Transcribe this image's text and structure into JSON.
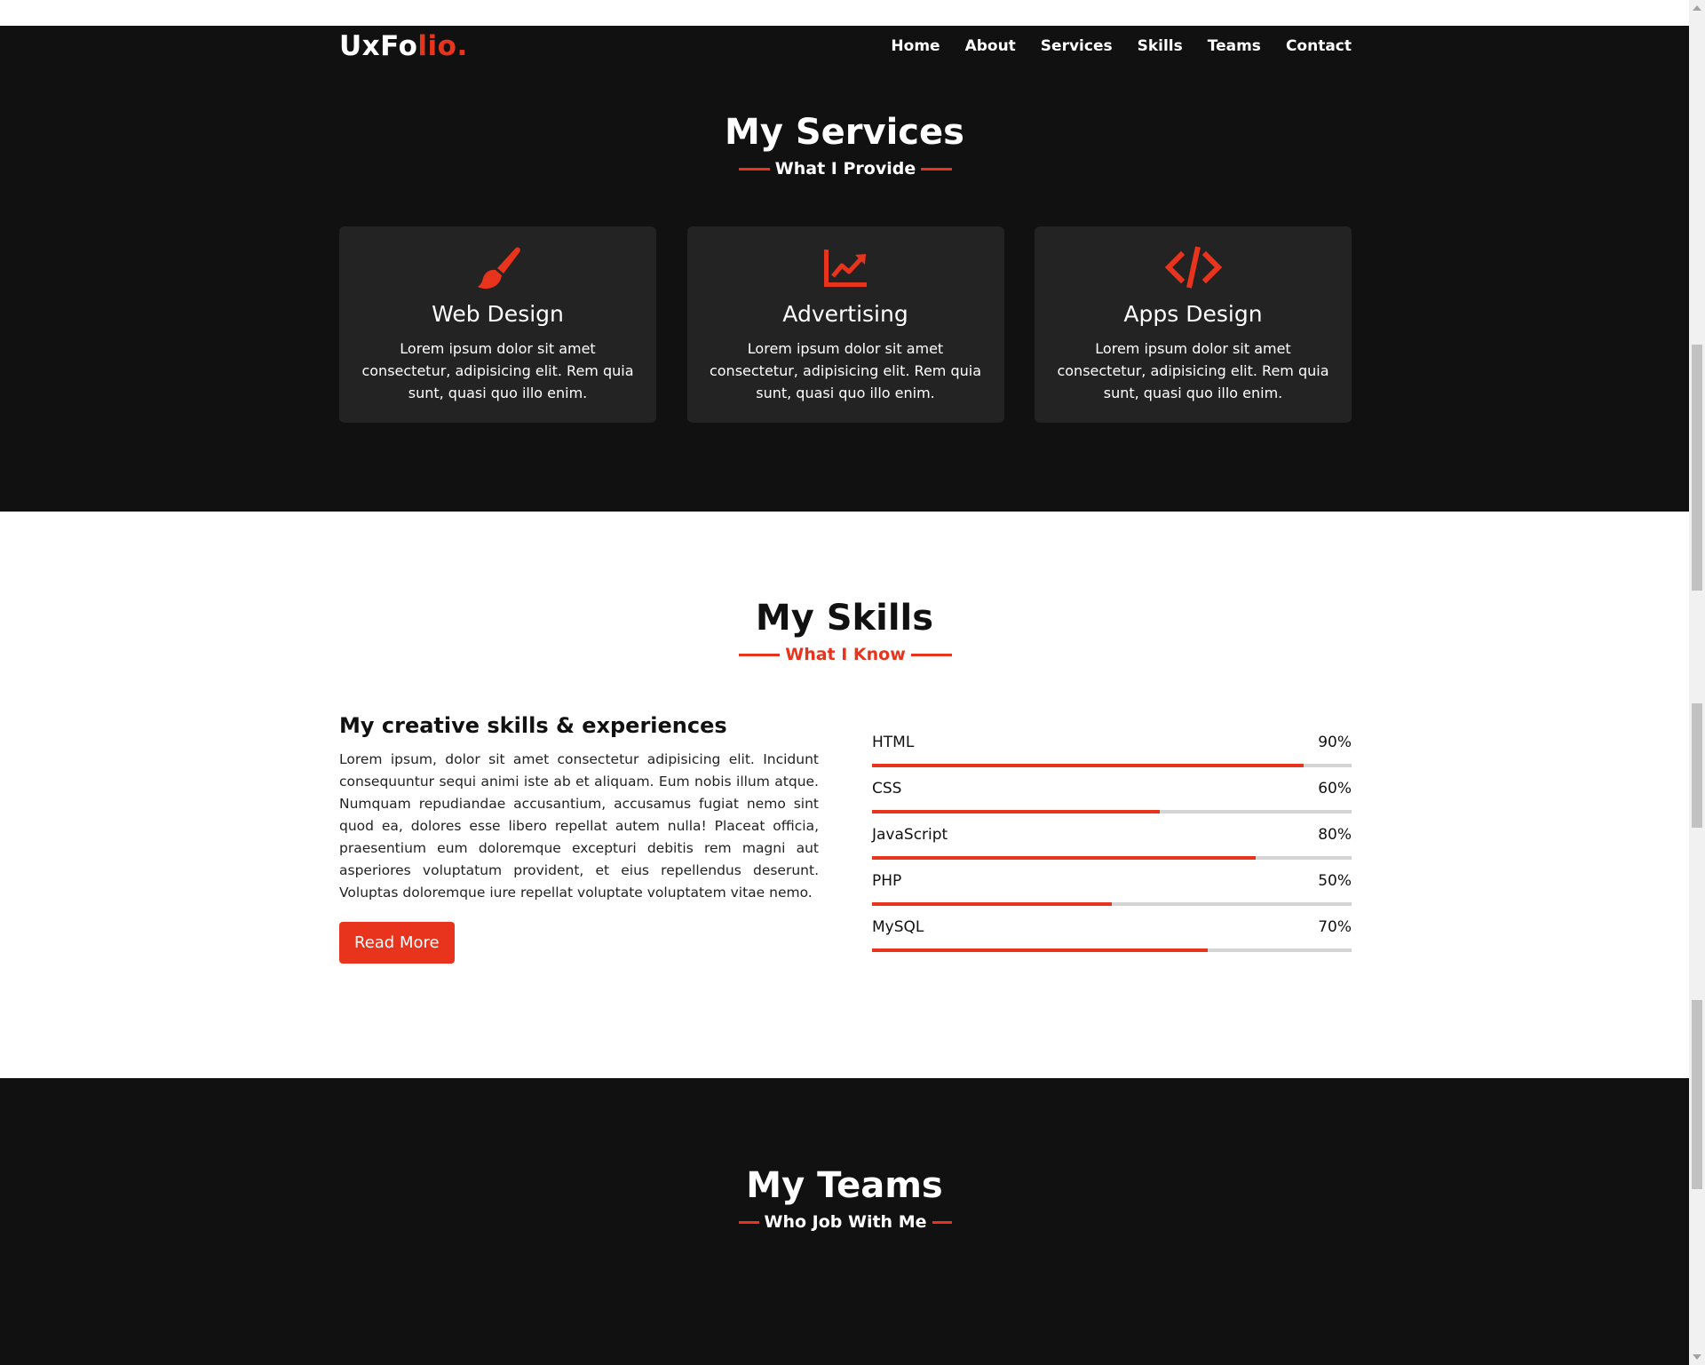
{
  "brand": {
    "part1": "UxFo",
    "part2": "lio."
  },
  "nav": [
    {
      "label": "Home"
    },
    {
      "label": "About"
    },
    {
      "label": "Services"
    },
    {
      "label": "Skills"
    },
    {
      "label": "Teams"
    },
    {
      "label": "Contact"
    }
  ],
  "services": {
    "title": "My Services",
    "subtitle": "What I Provide",
    "cards": [
      {
        "icon": "paint-brush-icon",
        "title": "Web Design",
        "text": "Lorem ipsum dolor sit amet consectetur, adipisicing elit. Rem quia sunt, quasi quo illo enim."
      },
      {
        "icon": "chart-line-icon",
        "title": "Advertising",
        "text": "Lorem ipsum dolor sit amet consectetur, adipisicing elit. Rem quia sunt, quasi quo illo enim."
      },
      {
        "icon": "code-icon",
        "title": "Apps Design",
        "text": "Lorem ipsum dolor sit amet consectetur, adipisicing elit. Rem quia sunt, quasi quo illo enim."
      }
    ]
  },
  "skills": {
    "title": "My Skills",
    "subtitle": "What I Know",
    "heading": "My creative skills & experiences",
    "paragraph": "Lorem ipsum, dolor sit amet consectetur adipisicing elit. Incidunt consequuntur sequi animi iste ab et aliquam. Eum nobis illum atque. Numquam repudiandae accusantium, accusamus fugiat nemo sint quod ea, dolores esse libero repellat autem nulla! Placeat officia, praesentium eum doloremque excepturi debitis rem magni aut asperiores voluptatum provident, et eius repellendus deserunt. Voluptas doloremque iure repellat voluptate voluptatem vitae nemo.",
    "button": "Read More",
    "bars": [
      {
        "name": "HTML",
        "percent_label": "90%",
        "value": 90
      },
      {
        "name": "CSS",
        "percent_label": "60%",
        "value": 60
      },
      {
        "name": "JavaScript",
        "percent_label": "80%",
        "value": 80
      },
      {
        "name": "PHP",
        "percent_label": "50%",
        "value": 50
      },
      {
        "name": "MySQL",
        "percent_label": "70%",
        "value": 70
      }
    ]
  },
  "teams": {
    "title": "My Teams",
    "subtitle": "Who Job With Me"
  },
  "colors": {
    "accent": "#e8341c",
    "dark_bg": "#111111",
    "card_bg": "#232323"
  }
}
